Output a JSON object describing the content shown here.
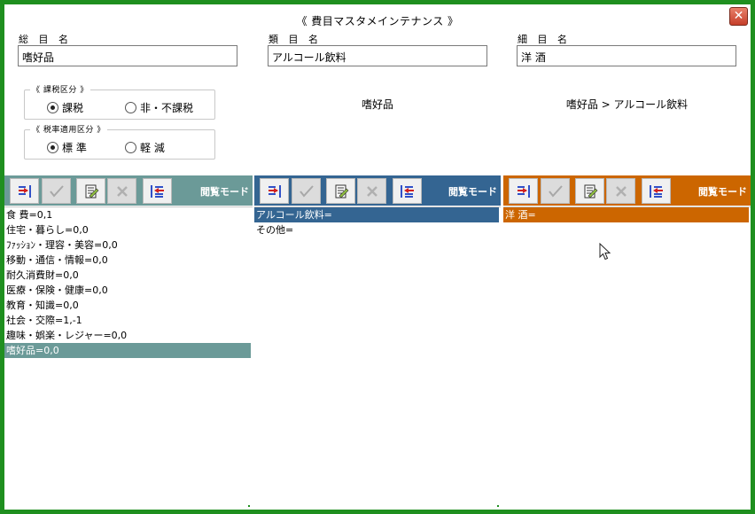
{
  "window": {
    "title": "《 費目マスタメインテナンス 》",
    "close_label": "✕"
  },
  "colors": {
    "frame": "#1f8f1f",
    "col1_accent": "#6b9a98",
    "col2_accent": "#346592",
    "col3_accent": "#cc6600"
  },
  "columns": [
    {
      "label": "総 目 名",
      "input_value": "嗜好品",
      "path": "",
      "mode": "閲覧モード",
      "items": [
        "食 費=0,1",
        "住宅・暮らし=0,0",
        "ﾌｧｯｼｮﾝ・理容・美容=0,0",
        "移動・通信・情報=0,0",
        "耐久消費財=0,0",
        "医療・保険・健康=0,0",
        "教育・知識=0,0",
        "社会・交際=1,-1",
        "趣味・娯楽・レジャー=0,0",
        "嗜好品=0,0"
      ],
      "selected_index": 9
    },
    {
      "label": "類 目 名",
      "input_value": "アルコール飲料",
      "path": "嗜好品",
      "mode": "閲覧モード",
      "items": [
        "アルコール飲料=",
        "その他="
      ],
      "selected_index": 0
    },
    {
      "label": "細 目 名",
      "input_value": "洋 酒",
      "path": "嗜好品 > アルコール飲料",
      "mode": "閲覧モード",
      "items": [
        "洋 酒="
      ],
      "selected_index": 0
    }
  ],
  "tax_group": {
    "title": "《 課税区分 》",
    "options": [
      "課税",
      "非・不課税"
    ],
    "selected": "課税"
  },
  "rate_group": {
    "title": "《 税率適用区分 》",
    "options": [
      "標 準",
      "軽 減"
    ],
    "selected": "標 準"
  },
  "toolbar_icons": [
    "move-icon",
    "check-icon",
    "edit-icon",
    "delete-icon",
    "sort-icon"
  ]
}
